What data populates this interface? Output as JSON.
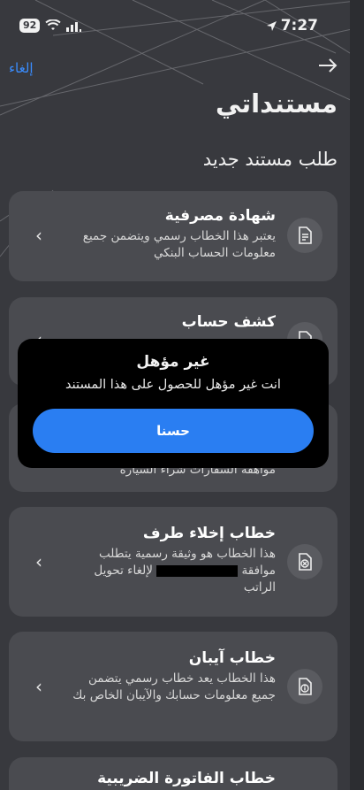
{
  "status_bar": {
    "battery": "92",
    "time": "7:27"
  },
  "header": {
    "cancel_label": "إلغاء",
    "back_icon": "arrow-right-icon",
    "title": "مستنداتي"
  },
  "section": {
    "title": "طلب مستند جديد"
  },
  "cards": [
    {
      "title": "شهادة مصرفية",
      "desc": "يعتبر هذا الخطاب رسمي ويتضمن جميع معلومات الحساب البنكي",
      "icon": "document-text-icon"
    },
    {
      "title": "كشف حساب",
      "icon": "document-icon"
    },
    {
      "desc_partial": "مواهقة السفارات شراء السيارة",
      "icon": "document-icon"
    },
    {
      "title": "خطاب إخلاء طرف",
      "desc_a": "هذا الخطاب هو وثيقة رسمية يتطلب",
      "desc_b_prefix": "موافقة",
      "desc_b_suffix": "لإلغاء تحويل",
      "desc_c": "الراتب",
      "icon": "document-x-icon"
    },
    {
      "title": "خطاب آيبان",
      "desc": "هذا الخطاب يعد خطاب رسمي يتضمن جميع معلومات حسابك والآيبان الخاص بك",
      "icon": "document-info-icon"
    },
    {
      "title_partial": "خطاب الفاتورة الضريبية"
    }
  ],
  "dialog": {
    "title": "غير مؤهل",
    "message": "انت غير مؤهل للحصول على هذا المستند",
    "button_label": "حسنا"
  }
}
